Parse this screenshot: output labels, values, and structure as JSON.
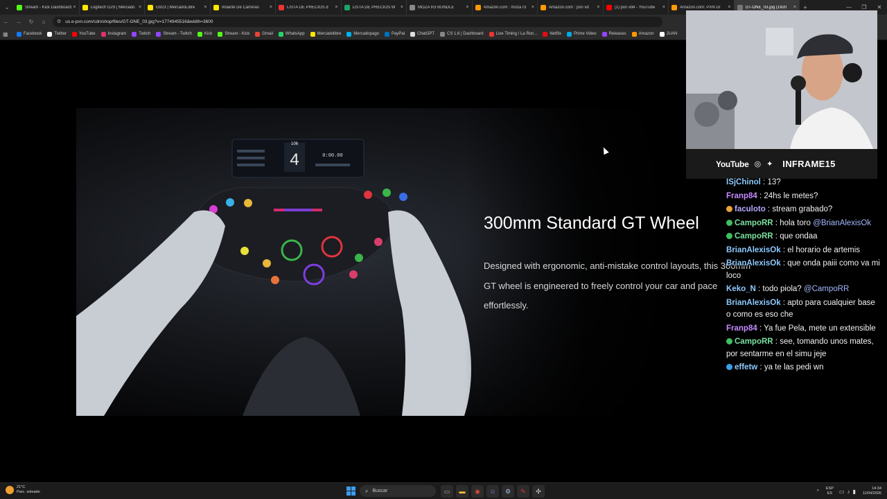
{
  "browser": {
    "tabs": [
      {
        "label": "Stream - Kick Dashboard",
        "color": "#53fc18",
        "active": false
      },
      {
        "label": "Logitech G29 | Mercado",
        "color": "#ffe600",
        "active": false
      },
      {
        "label": "G923 | MercadoLibre",
        "color": "#ffe600",
        "active": false
      },
      {
        "label": "Volante De Carreras",
        "color": "#ffe600",
        "active": false
      },
      {
        "label": "LISTA DE PRECIOS d",
        "color": "#e33",
        "active": false
      },
      {
        "label": "LISTA DE PRECIOS W",
        "color": "#1fa463",
        "active": false
      },
      {
        "label": "MOZA R3 BUNDLE",
        "color": "#888",
        "active": false
      },
      {
        "label": "Amazon.com : moza r3",
        "color": "#ff9900",
        "active": false
      },
      {
        "label": "Amazon.com : pxn vd",
        "color": "#ff9900",
        "active": false
      },
      {
        "label": "(1) pxn vd4 - YouTube",
        "color": "#f00",
        "active": false
      },
      {
        "label": "Amazon.com: PXN Dr",
        "color": "#ff9900",
        "active": false
      },
      {
        "label": "GT-ONE_03.jpg (1920",
        "color": "#777",
        "active": true
      }
    ],
    "new_tab_symbol": "+",
    "url": "us.e-pxn.com/cdn/shop/files/GT-ONE_03.jpg?v=1774945516&width=3600",
    "bookmarks": [
      {
        "label": "Facebook",
        "color": "#1877f2"
      },
      {
        "label": "Twitter",
        "color": "#fff"
      },
      {
        "label": "YouTube",
        "color": "#f00"
      },
      {
        "label": "Instagram",
        "color": "#e1306c"
      },
      {
        "label": "Twitch",
        "color": "#9146ff"
      },
      {
        "label": "Stream - Twitch",
        "color": "#9146ff"
      },
      {
        "label": "Kick",
        "color": "#53fc18"
      },
      {
        "label": "Stream - Kick",
        "color": "#53fc18"
      },
      {
        "label": "Gmail",
        "color": "#ea4335"
      },
      {
        "label": "WhatsApp",
        "color": "#25d366"
      },
      {
        "label": "Mercadolibre",
        "color": "#ffe600"
      },
      {
        "label": "Mercadopago",
        "color": "#00b1ea"
      },
      {
        "label": "PayPal",
        "color": "#0070ba"
      },
      {
        "label": "ChatGPT",
        "color": "#ddd"
      },
      {
        "label": "CS 1.6 | Dashboard",
        "color": "#888"
      },
      {
        "label": "Live Timing / La Ron...",
        "color": "#e33"
      },
      {
        "label": "Netflix",
        "color": "#e50914"
      },
      {
        "label": "Prime Video",
        "color": "#00a8e1"
      },
      {
        "label": "Releases",
        "color": "#9146ff"
      },
      {
        "label": "Amazon",
        "color": "#ff9900"
      },
      {
        "label": "JUAN",
        "color": "#fff"
      }
    ]
  },
  "hero": {
    "title": "300mm Standard GT Wheel",
    "description": "Designed with ergonomic, anti-mistake control layouts, this 300mm GT wheel is engineered to freely control your car and pace effortlessly.",
    "gear_display": "4",
    "speed_display": "106",
    "lap_time": "0:00.00"
  },
  "stream": {
    "platform": "YouTube",
    "handle": "INFRAME15",
    "chat": [
      {
        "user": "ISjChinol",
        "color": "#8ec9ff",
        "badge": "",
        "text": "13?",
        "mention": ""
      },
      {
        "user": "Franp84",
        "color": "#c58cff",
        "badge": "",
        "text": "24hs le metes?",
        "mention": ""
      },
      {
        "user": "faculoto",
        "color": "#b5a8ff",
        "badge": "#e8a33a",
        "text": "stream grabado?",
        "mention": ""
      },
      {
        "user": "CampoRR",
        "color": "#7be0a0",
        "badge": "#3fbf5f",
        "text": "hola toro",
        "mention": "@BrianAlexisOk"
      },
      {
        "user": "CampoRR",
        "color": "#7be0a0",
        "badge": "#3fbf5f",
        "text": "que ondaa",
        "mention": ""
      },
      {
        "user": "BrianAlexisOk",
        "color": "#8ec9ff",
        "badge": "",
        "text": "el horario de artemis",
        "mention": ""
      },
      {
        "user": "BrianAlexisOk",
        "color": "#8ec9ff",
        "badge": "",
        "text": "que onda paiii como va mi loco",
        "mention": ""
      },
      {
        "user": "Keko_N",
        "color": "#8ec9ff",
        "badge": "",
        "text": "todo piola?",
        "mention": "@CampoRR"
      },
      {
        "user": "BrianAlexisOk",
        "color": "#8ec9ff",
        "badge": "",
        "text": "apto para cualquier base o como es eso che",
        "mention": ""
      },
      {
        "user": "Franp84",
        "color": "#c58cff",
        "badge": "",
        "text": "Ya fue Pela, mete un extensible",
        "mention": ""
      },
      {
        "user": "CampoRR",
        "color": "#7be0a0",
        "badge": "#3fbf5f",
        "text": "see, tomando unos mates, por sentarme en el simu jeje",
        "mention": ""
      },
      {
        "user": "effetw",
        "color": "#8ec9ff",
        "badge": "#3aa0e8",
        "text": "ya te las pedi wn",
        "mention": ""
      }
    ]
  },
  "taskbar": {
    "temp": "21°C",
    "weather": "Parc. soleado",
    "search_placeholder": "Buscar",
    "lang_top": "ESP",
    "lang_bottom": "ES",
    "time": "14:34",
    "date": "11/04/2026"
  }
}
